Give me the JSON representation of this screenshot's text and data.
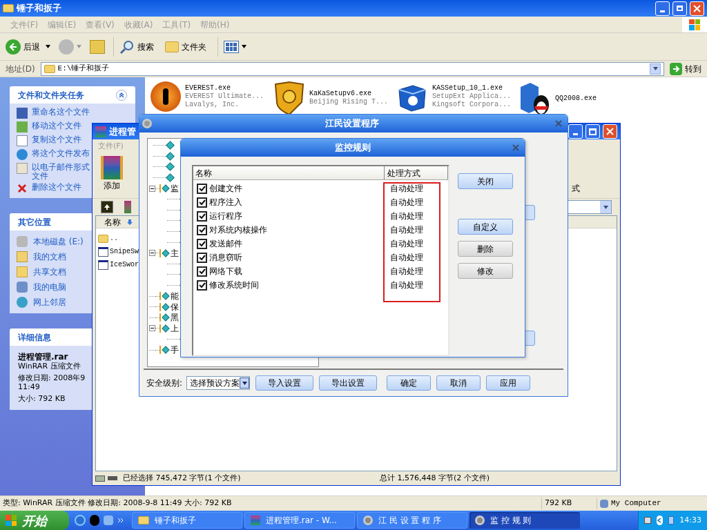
{
  "explorer": {
    "title": "锤子和扳子",
    "menu": [
      "文件(F)",
      "编辑(E)",
      "查看(V)",
      "收藏(A)",
      "工具(T)",
      "帮助(H)"
    ],
    "toolbar": {
      "back": "后退",
      "search": "搜索",
      "folders": "文件夹"
    },
    "address": {
      "label": "地址(D)",
      "value": "E:\\锤子和扳子",
      "go": "转到"
    },
    "tasks": {
      "title": "文件和文件夹任务",
      "expanded": true,
      "items": [
        {
          "label": "重命名这个文件",
          "kind": "rename"
        },
        {
          "label": "移动这个文件",
          "kind": "move"
        },
        {
          "label": "复制这个文件",
          "kind": "copy"
        },
        {
          "label": "将这个文件发布",
          "kind": "publish"
        },
        {
          "label": "以电子邮件形式",
          "label_2": "文件",
          "kind": "mail"
        },
        {
          "label": "删除这个文件",
          "kind": "delete"
        }
      ]
    },
    "other_places": {
      "title": "其它位置",
      "items": [
        {
          "label": "本地磁盘 (E:)",
          "kind": "disk"
        },
        {
          "label": "我的文档",
          "kind": "docs"
        },
        {
          "label": "共享文档",
          "kind": "folder"
        },
        {
          "label": "我的电脑",
          "kind": "computer"
        },
        {
          "label": "网上邻居",
          "kind": "network"
        }
      ]
    },
    "details": {
      "title": "详细信息",
      "name": "进程管理.rar",
      "type": "WinRAR 压缩文件",
      "modified": "修改日期: 2008年9",
      "time": "11:49",
      "size": "大小: 792 KB"
    },
    "files": [
      {
        "name": "EVEREST.exe",
        "line2": "EVEREST Ultimate...",
        "line3": "Lavalys, Inc.",
        "kind": "info"
      },
      {
        "name": "KaKaSetupv6.exe",
        "line2": "Beijing Rising T...",
        "kind": "lion"
      },
      {
        "name": "KASSetup_10_1.exe",
        "line2": "SetupExt Applica...",
        "line3": "Kingsoft Corpora...",
        "kind": "box"
      },
      {
        "name": "QQ2008.exe",
        "kind": "penguin"
      }
    ],
    "status_bar": [
      "类型: WinRAR 压缩文件 修改日期: 2008-9-8 11:49 大小: 792 KB",
      "792 KB",
      "My Computer"
    ]
  },
  "winrar": {
    "title": "进程管",
    "menu": "文件(F)",
    "add": "添加",
    "column": "名称",
    "files": [
      {
        "name": "..",
        "kind": "folder"
      },
      {
        "name": "SnipeSw",
        "kind": "app"
      },
      {
        "name": "IceSwor",
        "kind": "app"
      }
    ],
    "fragment": "式",
    "status_selected": "已经选择 745,472 字节(1 个文件)",
    "status_total": "总计 1,576,448 字节(2 个文件)"
  },
  "settings": {
    "title": "江民设置程序",
    "tree": [
      {
        "kind": "leaf"
      },
      {
        "kind": "leaf"
      },
      {
        "kind": "leaf"
      },
      {
        "kind": "leaf"
      },
      {
        "kind": "node",
        "label": "监",
        "expanded": true,
        "children": [
          {
            "kind": "leaf"
          },
          {
            "kind": "leaf"
          },
          {
            "kind": "leaf"
          },
          {
            "kind": "leaf"
          },
          {
            "kind": "leaf"
          }
        ]
      },
      {
        "kind": "node",
        "label": "主",
        "expanded": true,
        "children": [
          {
            "kind": "leaf"
          },
          {
            "kind": "leaf"
          },
          {
            "kind": "leaf"
          }
        ]
      },
      {
        "kind": "node",
        "label": "能"
      },
      {
        "kind": "node",
        "label": "保"
      },
      {
        "kind": "node",
        "label": "黑"
      },
      {
        "kind": "node",
        "label": "上",
        "expanded": true,
        "children": [
          {
            "kind": "leaf"
          }
        ]
      },
      {
        "kind": "node",
        "label": "手"
      }
    ],
    "security_label": "安全级别:",
    "preset": "选择预设方案",
    "buttons": [
      "导入设置",
      "导出设置",
      "确定",
      "取消",
      "应用"
    ]
  },
  "rules": {
    "title": "监控规则",
    "columns": [
      "名称",
      "处理方式"
    ],
    "action_column_highlighted": true,
    "rows": [
      {
        "name": "创建文件",
        "action": "自动处理",
        "checked": true
      },
      {
        "name": "程序注入",
        "action": "自动处理",
        "checked": true
      },
      {
        "name": "运行程序",
        "action": "自动处理",
        "checked": true
      },
      {
        "name": "对系统内核操作",
        "action": "自动处理",
        "checked": true
      },
      {
        "name": "发送邮件",
        "action": "自动处理",
        "checked": true
      },
      {
        "name": "消息窃听",
        "action": "自动处理",
        "checked": true
      },
      {
        "name": "网络下载",
        "action": "自动处理",
        "checked": true
      },
      {
        "name": "修改系统时间",
        "action": "自动处理",
        "checked": true
      }
    ],
    "buttons": [
      {
        "label": "关闭",
        "kind": "accent"
      },
      {
        "label": "自定义",
        "kind": "accent"
      },
      {
        "label": "删除",
        "kind": "plain"
      },
      {
        "label": "修改",
        "kind": "plain"
      }
    ]
  },
  "taskbar": {
    "start": "开始",
    "tasks": [
      {
        "label": "锤子和扳子",
        "kind": "folder",
        "selected": false
      },
      {
        "label": "进程管理.rar - W...",
        "kind": "rar",
        "selected": false
      },
      {
        "label": "江 民 设 置 程 序",
        "kind": "gear",
        "selected": false
      },
      {
        "label": "监 控 规 则",
        "kind": "gear",
        "selected": true
      }
    ],
    "clock": "14:33"
  }
}
